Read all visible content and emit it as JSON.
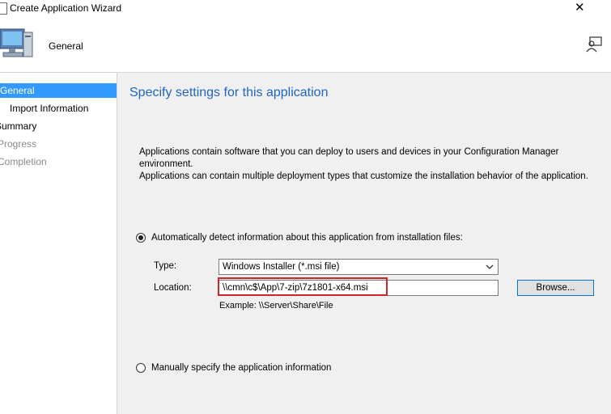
{
  "window": {
    "title": "Create Application Wizard"
  },
  "header": {
    "page_name": "General"
  },
  "sidebar": {
    "items": [
      {
        "label": "General"
      },
      {
        "label": "Import Information"
      },
      {
        "label": "Summary"
      },
      {
        "label": "Progress"
      },
      {
        "label": "Completion"
      }
    ]
  },
  "main": {
    "heading": "Specify settings for this application",
    "description_line1": "Applications contain software that you can deploy to users and devices in your Configuration Manager environment.",
    "description_line2": "Applications can contain multiple deployment types that customize the installation behavior of the application.",
    "auto_option": {
      "label": "Automatically detect information about this application from installation files:",
      "selected": true
    },
    "type": {
      "label": "Type:",
      "value": "Windows Installer (*.msi file)"
    },
    "location": {
      "label": "Location:",
      "value": "\\\\cmn\\c$\\App\\7-zip\\7z1801-x64.msi"
    },
    "browse_label": "Browse...",
    "example": "Example: \\\\Server\\Share\\File",
    "manual_option": {
      "label": "Manually specify the application information",
      "selected": false
    }
  },
  "colors": {
    "accent": "#3399ff",
    "heading": "#1f64c8",
    "highlight": "#d0262b"
  }
}
